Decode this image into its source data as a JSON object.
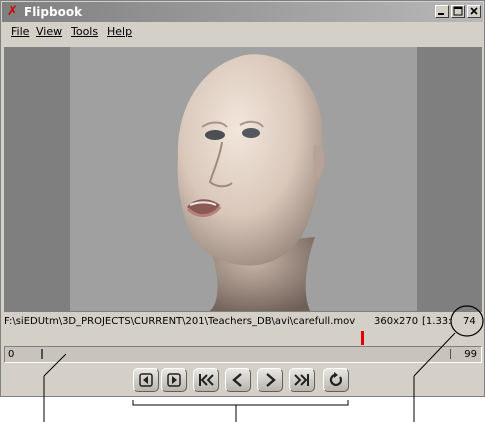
{
  "window": {
    "title": "Flipbook",
    "controls": [
      "minimize",
      "maximize",
      "close"
    ]
  },
  "menu": {
    "items": [
      "File",
      "View",
      "Tools",
      "Help"
    ]
  },
  "viewer": {
    "content": "3D rendered bald human head, mouth open, facing left, neutral gray background"
  },
  "status": {
    "file_path": "F:\\siEDUtm\\3D_PROJECTS\\CURRENT\\201\\Teachers_DB\\avi\\carefull.mov",
    "resolution": "360x270",
    "aspect": "[1.33:",
    "current_frame": "74"
  },
  "timeline": {
    "start": "0",
    "end": "99"
  },
  "transport": {
    "buttons": [
      "previous-frame",
      "next-frame",
      "rewind-to-start",
      "play-backward",
      "play-forward",
      "fast-forward-to-end",
      "loop"
    ]
  },
  "colors": {
    "viewport_bg": "#7f7f7f",
    "frame_bg": "#a0a0a0",
    "cache_marker": "#e00000",
    "window_bg": "#d4d0c8"
  }
}
